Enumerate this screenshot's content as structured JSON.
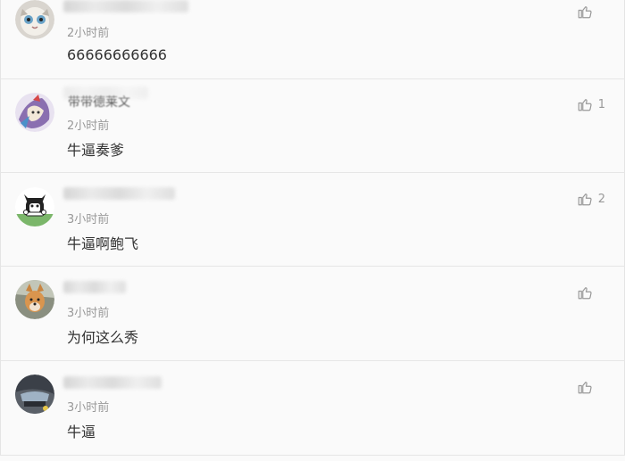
{
  "comments": [
    {
      "username": "",
      "time": "2小时前",
      "content": "66666666666",
      "likes": ""
    },
    {
      "username": "带带德莱文",
      "time": "2小时前",
      "content": "牛逼奏爹",
      "likes": "1"
    },
    {
      "username": "",
      "time": "3小时前",
      "content": "牛逼啊鲍飞",
      "likes": "2"
    },
    {
      "username": "",
      "time": "3小时前",
      "content": "为何这么秀",
      "likes": ""
    },
    {
      "username": "",
      "time": "3小时前",
      "content": "牛逼",
      "likes": ""
    }
  ],
  "icons": {
    "like": "thumbs-up-icon"
  },
  "colors": {
    "background": "#fafafa",
    "time_text": "#999999",
    "content_text": "#333333",
    "divider": "#e6e6e6"
  }
}
